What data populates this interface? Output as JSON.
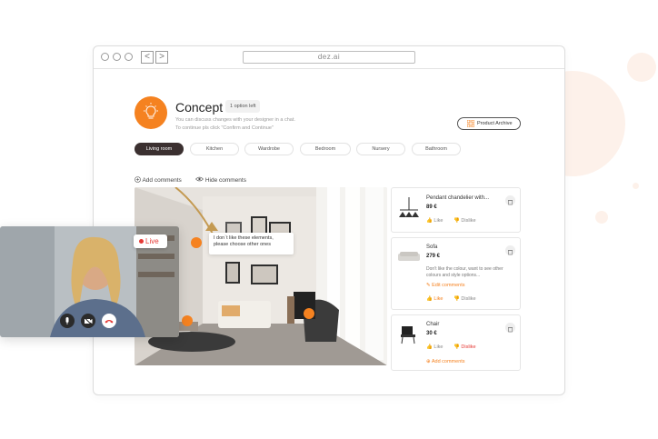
{
  "browser": {
    "url": "dez.ai",
    "back": "<",
    "forward": ">"
  },
  "concept": {
    "title": "Concept",
    "badge": "1 option left",
    "desc_line1": "You can discuss changes with your designer in a chat.",
    "desc_line2": "To continue pls click \"Confirm and Continue\"",
    "archive_button": "Product Archive"
  },
  "tabs": [
    {
      "label": "Living room",
      "active": true
    },
    {
      "label": "Kitchen",
      "active": false
    },
    {
      "label": "Wardrobe",
      "active": false
    },
    {
      "label": "Bedroom",
      "active": false
    },
    {
      "label": "Nursery",
      "active": false
    },
    {
      "label": "Bathroom",
      "active": false
    }
  ],
  "controls": {
    "add_comments": "Add comments",
    "hide_comments": "Hide comments"
  },
  "tooltip": {
    "line1": "I don`t like these elements,",
    "line2": "please choose other ones"
  },
  "products": [
    {
      "name": "Pendant chandelier with...",
      "price": "89 €",
      "like": "Like",
      "dislike": "Dislike"
    },
    {
      "name": "Sofa",
      "price": "279 €",
      "desc_line1": "Don't like the colour, want to see other",
      "desc_line2": "colours and style options...",
      "edit": "Edit comments",
      "like": "Like",
      "dislike": "Dislike"
    },
    {
      "name": "Chair",
      "price": "30 €",
      "like": "Like",
      "dislike": "Dislike",
      "add": "Add comments"
    }
  ],
  "video": {
    "live": "Live"
  },
  "colors": {
    "accent": "#f58220",
    "dark": "#3b3030",
    "red": "#e53935"
  }
}
